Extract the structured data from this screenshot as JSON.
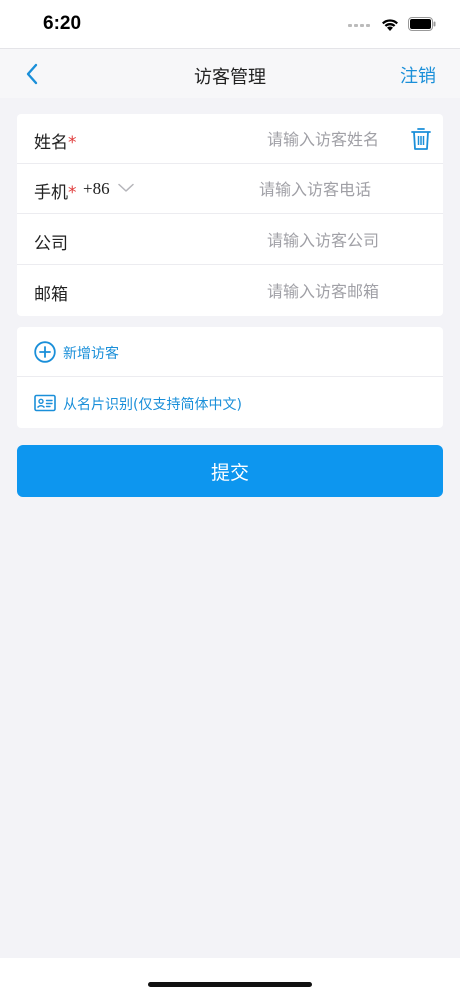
{
  "status": {
    "time": "6:20"
  },
  "nav": {
    "title": "访客管理",
    "logout_label": "注销"
  },
  "form": {
    "name": {
      "label": "姓名",
      "required": "*",
      "placeholder": "请输入访客姓名",
      "value": ""
    },
    "phone": {
      "label": "手机",
      "required": "*",
      "country_code": "+86",
      "placeholder": "请输入访客电话",
      "value": ""
    },
    "company": {
      "label": "公司",
      "placeholder": "请输入访客公司",
      "value": ""
    },
    "email": {
      "label": "邮箱",
      "placeholder": "请输入访客邮箱",
      "value": ""
    }
  },
  "actions": {
    "add_visitor_label": "新增访客",
    "scan_card_label": "从名片识别(仅支持简体中文)"
  },
  "submit_label": "提交",
  "colors": {
    "accent": "#1a8fd9",
    "button": "#0d96ef",
    "required": "#e03b3b",
    "background": "#f3f3f7"
  },
  "icons": [
    "back-chevron-icon",
    "trash-icon",
    "chevron-down-icon",
    "add-circle-icon",
    "id-card-icon",
    "wifi-icon",
    "battery-icon",
    "cellular-signal-icon"
  ]
}
